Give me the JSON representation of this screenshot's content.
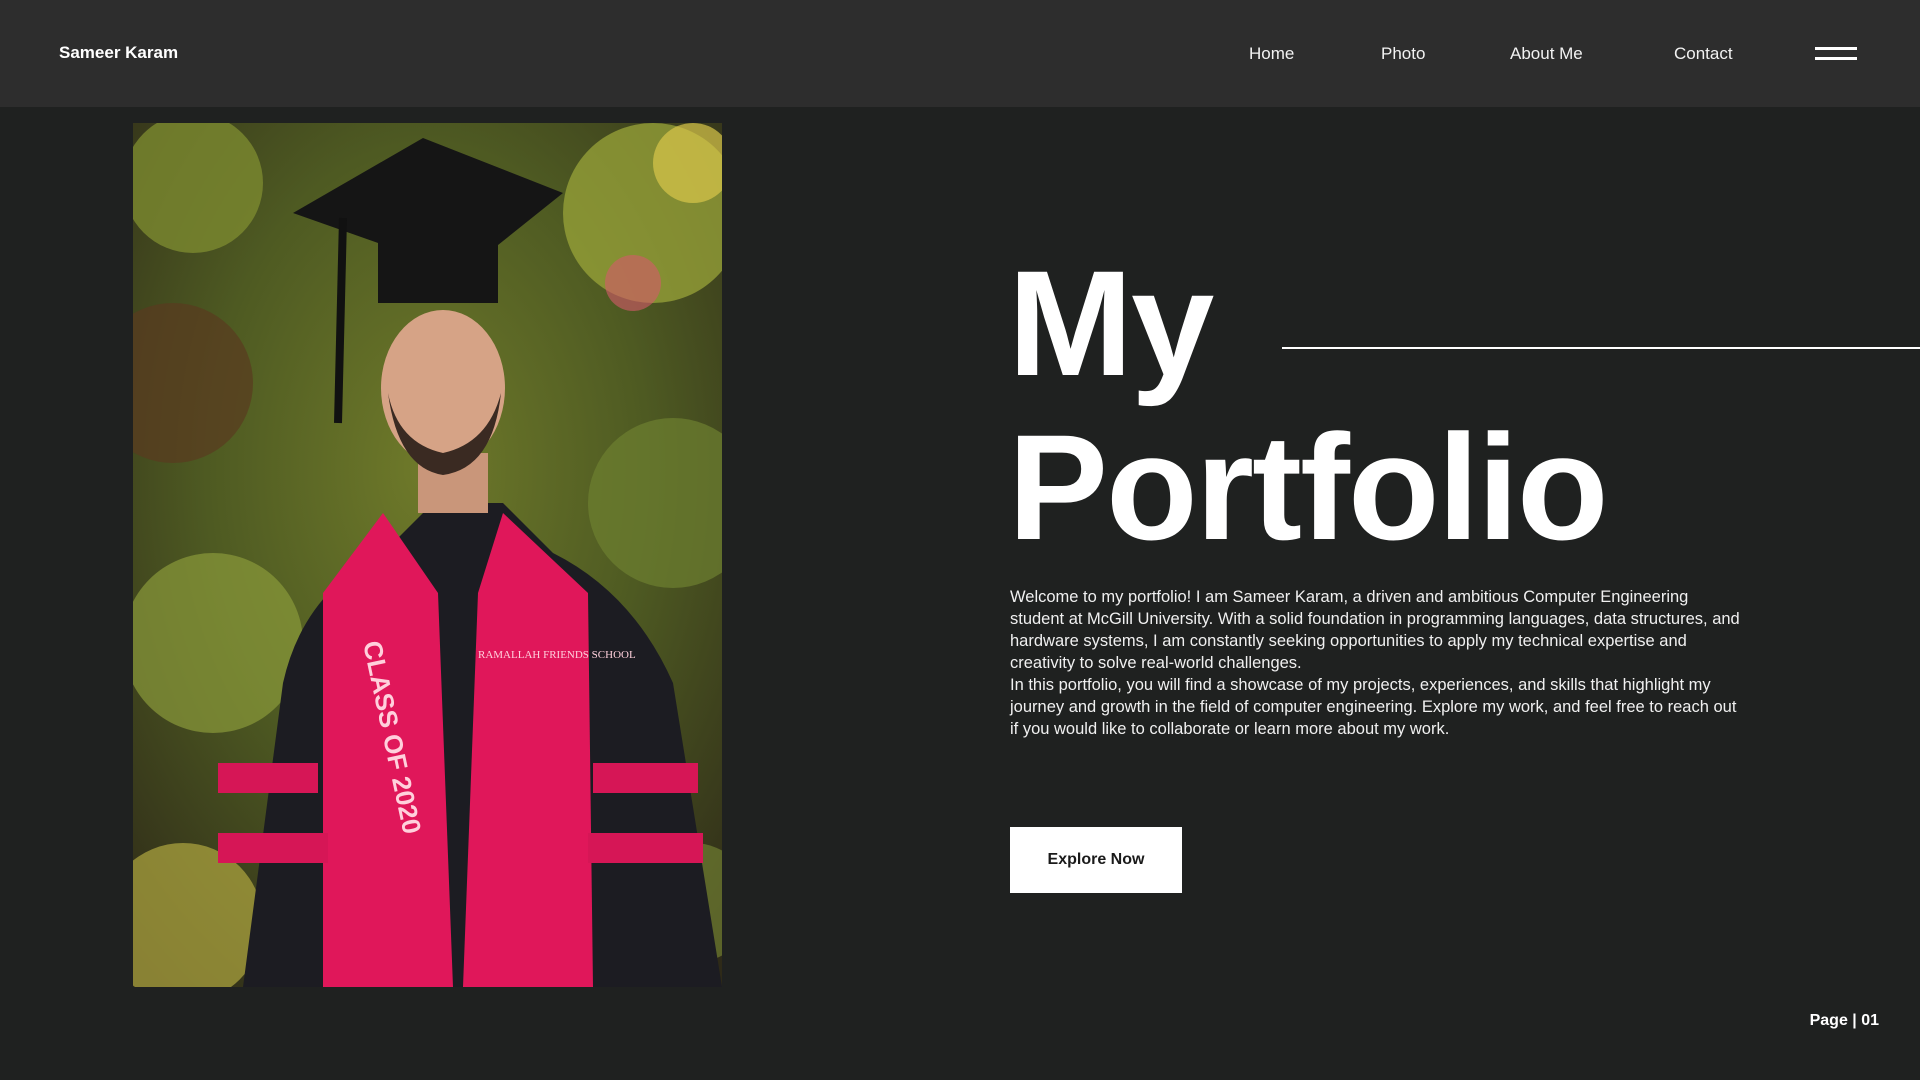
{
  "header": {
    "brand": "Sameer Karam",
    "nav": [
      "Home",
      "Photo",
      "About Me",
      "Contact"
    ],
    "menu_icon": "hamburger-menu-icon"
  },
  "hero": {
    "title_line1": "My",
    "title_line2": "Portfolio",
    "intro_p1": "Welcome to my portfolio! I am Sameer Karam, a driven and ambitious Computer Engineering student at McGill University. With a solid foundation in programming languages, data structures, and hardware systems, I am constantly seeking opportunities to apply my technical expertise and creativity to solve real-world challenges.",
    "intro_p2": "In this portfolio, you will find a showcase of my projects, experiences, and skills that highlight my journey and growth in the field of computer engineering. Explore my work, and feel free to reach out if you would like to collaborate or learn more about my work.",
    "cta_label": "Explore Now"
  },
  "photo": {
    "stole_text": "CLASS OF 2020",
    "stole_logo_text": "RAMALLAH FRIENDS SCHOOL"
  },
  "footer": {
    "page_indicator": "Page | 01"
  },
  "colors": {
    "background": "#1f2120",
    "topbar": "#2d2d2d",
    "text": "#ffffff",
    "button_bg": "#ffffff",
    "button_text": "#1a1a1a"
  }
}
